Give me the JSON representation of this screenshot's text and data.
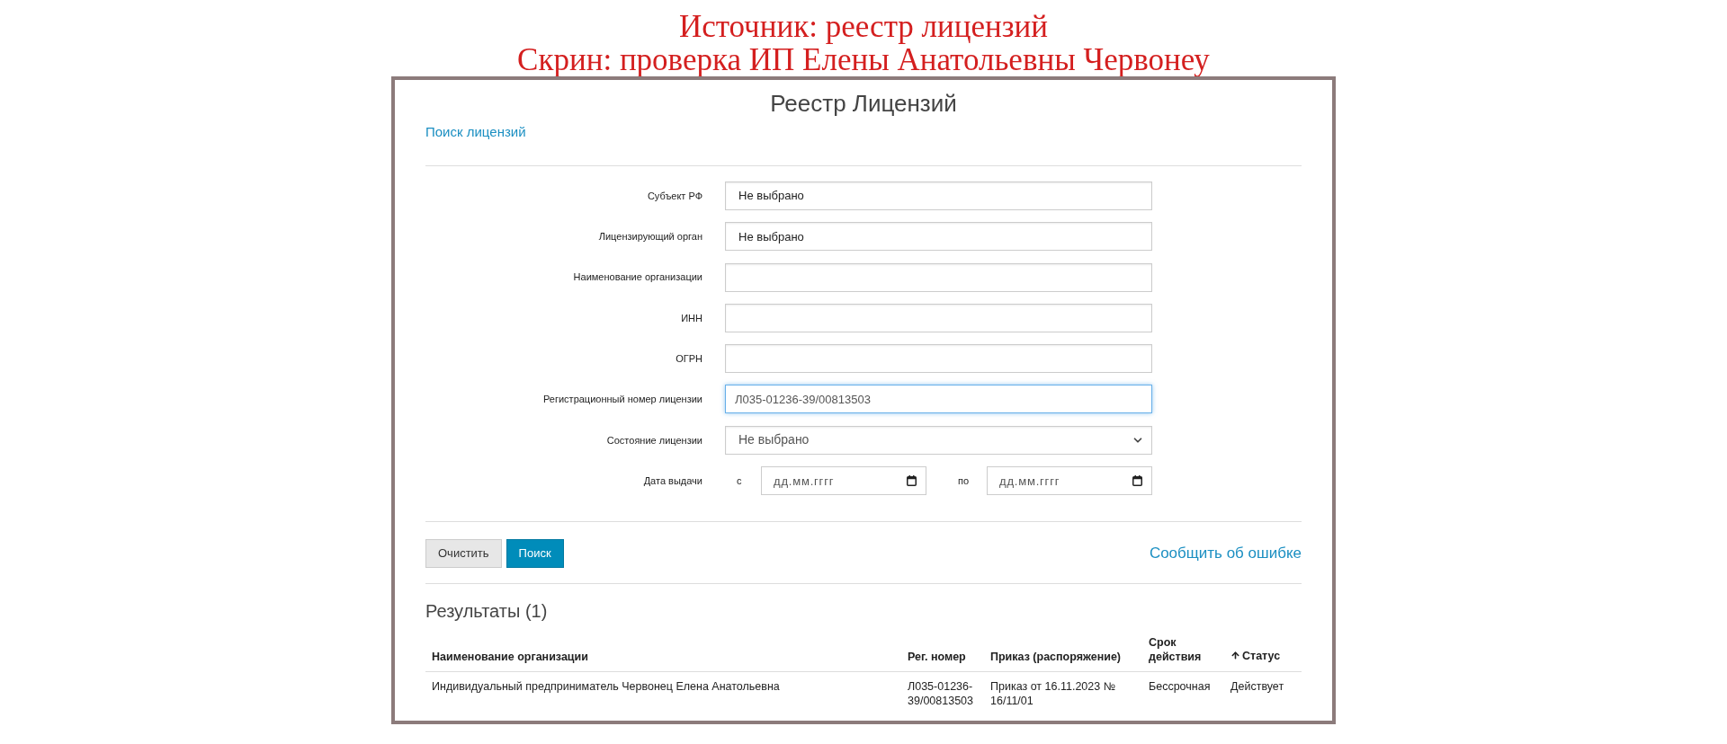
{
  "caption": [
    "Источник: реестр лицензий",
    "Скрин: проверка ИП Елены Анатольевны Червонеу"
  ],
  "page": {
    "title": "Реестр Лицензий",
    "search_link": "Поиск лицензий"
  },
  "form": {
    "fields": [
      {
        "label": "Субъект РФ",
        "kind": "picker",
        "value": "Не выбрано",
        "focused": false
      },
      {
        "label": "Лицензирующий орган",
        "kind": "picker",
        "value": "Не выбрано",
        "focused": false
      },
      {
        "label": "Наименование организации",
        "kind": "text",
        "focused": false
      },
      {
        "label": "ИНН",
        "kind": "text",
        "focused": false
      },
      {
        "label": "ОГРН",
        "kind": "text",
        "focused": false
      },
      {
        "label": "Регистрационный номер лицензии",
        "kind": "text",
        "value": "Л035-01236-39/00813503",
        "focused": true
      },
      {
        "label": "Состояние лицензии",
        "kind": "dropdown",
        "value": "Не выбрано",
        "focused": false
      },
      {
        "label": "Дата выдачи",
        "kind": "date_range",
        "from": {
          "label": "с",
          "placeholder": "дд.мм.гггг"
        },
        "to": {
          "label": "по",
          "placeholder": "дд.мм.гггг"
        }
      }
    ],
    "buttons": [
      {
        "label": "Очистить",
        "kind": "secondary"
      },
      {
        "label": "Поиск",
        "kind": "primary"
      }
    ],
    "report_link": "Сообщить об ошибке"
  },
  "results": {
    "heading": "Результаты (1)",
    "table": {
      "columns": [
        {
          "label": "Наименование организации",
          "sorted": false
        },
        {
          "label": "Рег. номер",
          "sorted": false
        },
        {
          "label": "Приказ (распоряжение)",
          "sorted": false
        },
        {
          "label": "Срок действия",
          "sorted": false
        },
        {
          "label": "Статус",
          "sorted": true
        }
      ],
      "rows": [
        [
          "Индивидуальный предприниматель Червонец Елена Анатольевна",
          "Л035-01236-39/00813503",
          "Приказ от 16.11.2023 № 16/11/01",
          "Бессрочная",
          "Действует"
        ]
      ]
    }
  }
}
